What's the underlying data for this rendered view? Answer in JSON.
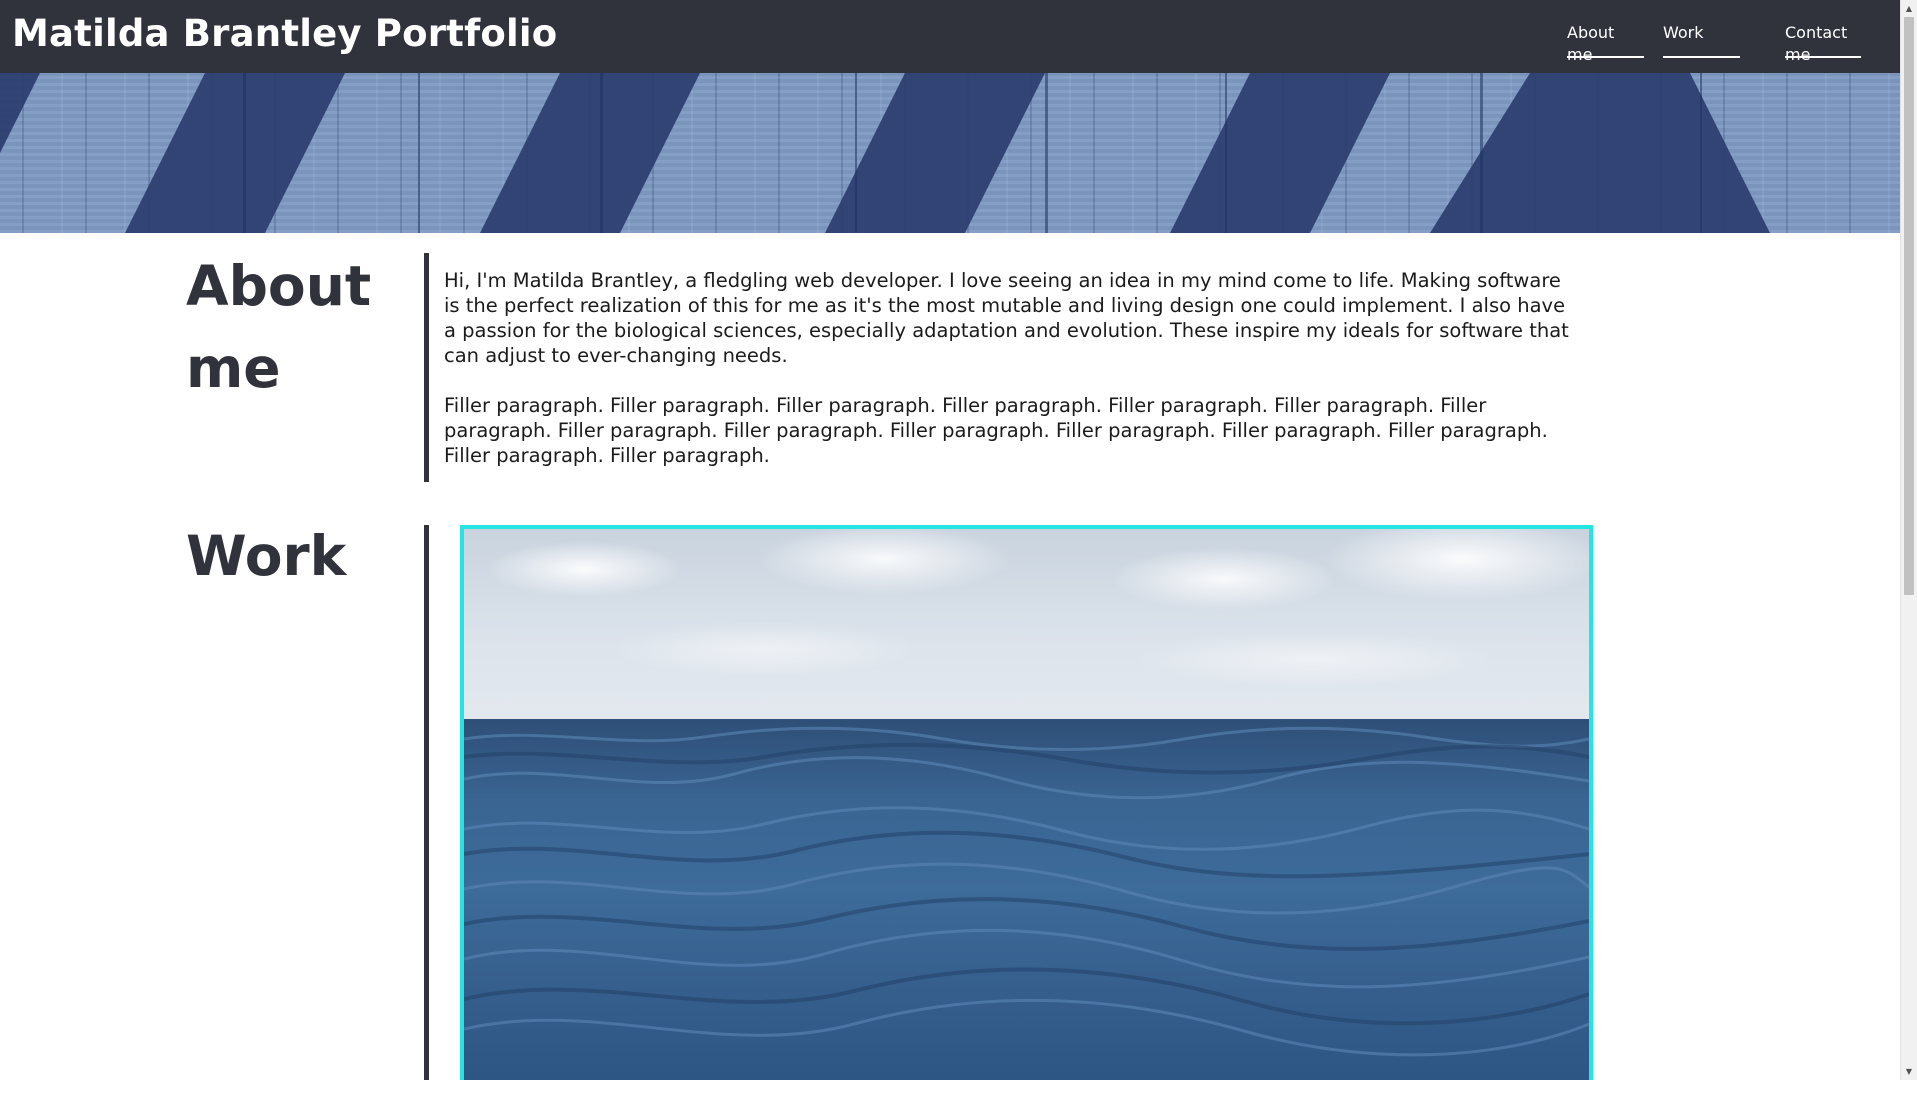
{
  "header": {
    "title": "Matilda Brantley Portfolio",
    "nav": [
      {
        "label": "About me"
      },
      {
        "label": "Work"
      },
      {
        "label": "Contact me"
      }
    ]
  },
  "about": {
    "heading_line1": "About",
    "heading_line2": "me",
    "paragraphs": [
      "Hi, I'm Matilda Brantley, a fledgling web developer. I love seeing an idea in my mind come to life. Making software is the perfect realization of this for me as it's the most mutable and living design one could implement. I also have a passion for the biological sciences, especially adaptation and evolution. These inspire my ideals for software that can adjust to ever-changing needs.",
      "Filler paragraph. Filler paragraph. Filler paragraph. Filler paragraph. Filler paragraph. Filler paragraph. Filler paragraph. Filler paragraph. Filler paragraph. Filler paragraph. Filler paragraph. Filler paragraph. Filler paragraph. Filler paragraph. Filler paragraph."
    ]
  },
  "work": {
    "heading": "Work"
  },
  "colors": {
    "header_bg": "#30333b",
    "accent_border": "#26e4e4",
    "text": "#30333b"
  },
  "icons": {
    "scroll_up": "▲",
    "scroll_down": "▼"
  }
}
